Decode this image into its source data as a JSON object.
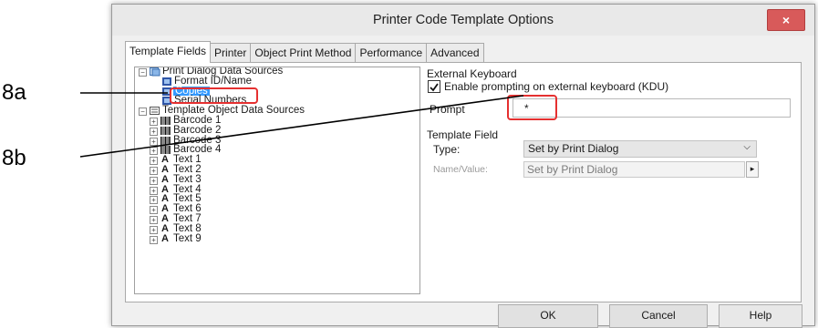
{
  "dialog": {
    "title": "Printer Code Template Options",
    "close_label": "×"
  },
  "tabs": [
    {
      "label": "Template Fields",
      "active": true
    },
    {
      "label": "Printer",
      "active": false
    },
    {
      "label": "Object Print Method",
      "active": false
    },
    {
      "label": "Performance",
      "active": false
    },
    {
      "label": "Advanced",
      "active": false
    }
  ],
  "tree": {
    "print_dialog": {
      "label": "Print Dialog Data Sources",
      "children": [
        "Format ID/Name",
        "Copies",
        "Serial Numbers"
      ],
      "selected": "Copies"
    },
    "template_objects": {
      "label": "Template Object Data Sources",
      "barcodes": [
        "Barcode 1",
        "Barcode 2",
        "Barcode 3",
        "Barcode 4"
      ],
      "texts": [
        "Text 1",
        "Text 2",
        "Text 3",
        "Text 4",
        "Text 5",
        "Text 6",
        "Text 7",
        "Text 8",
        "Text 9"
      ]
    }
  },
  "external_keyboard": {
    "group_label": "External Keyboard",
    "checkbox_label": "Enable prompting on external keyboard (KDU)",
    "checked": true,
    "prompt_label": "Prompt",
    "prompt_value": "*"
  },
  "template_field": {
    "group_label": "Template Field",
    "type_label": "Type:",
    "type_value": "Set by Print Dialog",
    "namevalue_label": "Name/Value:",
    "namevalue_value": "Set by Print Dialog",
    "browse_glyph": "▸"
  },
  "buttons": {
    "ok": "OK",
    "cancel": "Cancel",
    "help": "Help"
  },
  "callouts": {
    "a": "8a",
    "b": "8b"
  },
  "colors": {
    "highlight": "#e53030",
    "selection": "#3399ff",
    "close_button": "#d85a5a"
  }
}
